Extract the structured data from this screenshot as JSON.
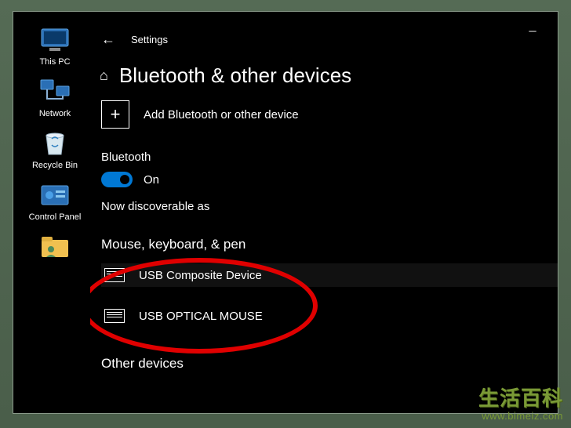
{
  "desktop": {
    "icons": [
      {
        "label": "This PC"
      },
      {
        "label": "Network"
      },
      {
        "label": "Recycle Bin"
      },
      {
        "label": "Control Panel"
      },
      {
        "label": ""
      }
    ]
  },
  "settings": {
    "app_title": "Settings",
    "page_title": "Bluetooth & other devices",
    "add_device_label": "Add Bluetooth or other device",
    "bluetooth_label": "Bluetooth",
    "toggle_state": "On",
    "discoverable_text": "Now discoverable as",
    "cat_mouse": "Mouse, keyboard, & pen",
    "devices": [
      {
        "name": "USB Composite Device"
      },
      {
        "name": "USB OPTICAL MOUSE"
      }
    ],
    "cat_other": "Other devices"
  },
  "watermark": {
    "line1": "生活百科",
    "line2": "www.bimeiz.com"
  }
}
